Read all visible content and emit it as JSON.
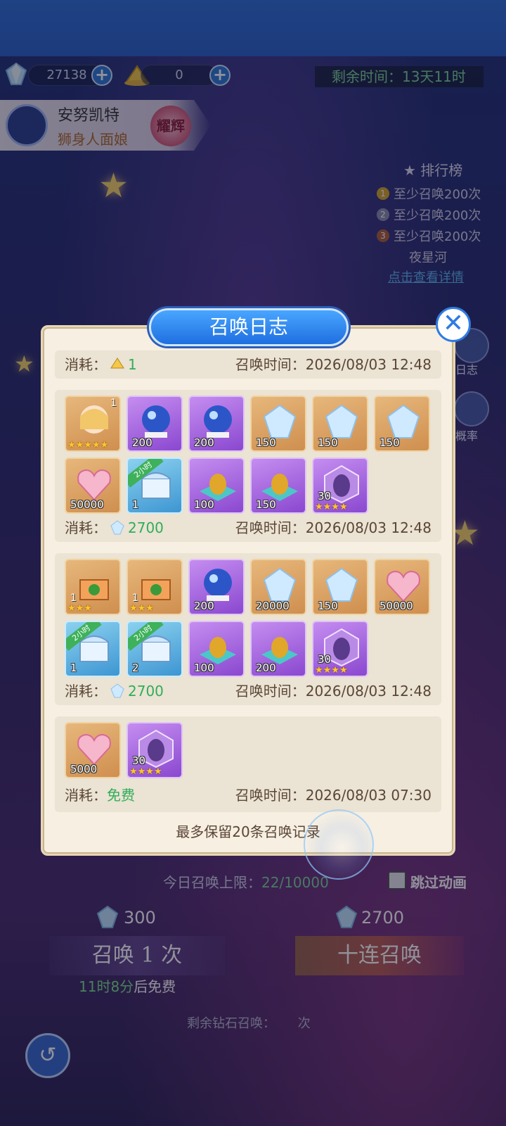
{
  "resources": {
    "gems": "27138",
    "bells": "0"
  },
  "timer": {
    "label": "剩余时间：",
    "value": "13天11时"
  },
  "hero": {
    "name": "安努凯特",
    "subtitle": "狮身人面娘",
    "badge": "耀辉"
  },
  "ranking": {
    "title": "排行榜",
    "lines": [
      "至少召唤200次",
      "至少召唤200次",
      "至少召唤200次"
    ],
    "extra": "夜星河",
    "link": "点击查看详情"
  },
  "side": {
    "log_label": "日志",
    "rate_label": "概率"
  },
  "modal": {
    "title": "召唤日志",
    "footer": "最多保留20条召唤记录",
    "entries": [
      {
        "cost_label": "消耗：",
        "cost_value": "1",
        "time_label": "召唤时间：",
        "time": "2026/08/03 12:48"
      },
      {
        "cost_label": "消耗：",
        "cost_value": "2700",
        "time_label": "召唤时间：",
        "time": "2026/08/03 12:48"
      },
      {
        "cost_label": "消耗：",
        "cost_value": "2700",
        "time_label": "召唤时间：",
        "time": "2026/08/03 12:48"
      },
      {
        "cost_label": "消耗：",
        "cost_value": "免费",
        "time_label": "召唤时间：",
        "time": "2026/08/03 07:30"
      }
    ],
    "items_b1": [
      "1",
      "200",
      "200",
      "150",
      "150",
      "150",
      "50000",
      "1",
      "100",
      "150",
      "30"
    ],
    "items_b2": [
      "1",
      "1",
      "200",
      "20000",
      "150",
      "50000",
      "1",
      "2",
      "100",
      "200",
      "30"
    ],
    "items_b3": [
      "5000",
      "30"
    ],
    "tag_label": "2小时",
    "stars_5": "★★★★★",
    "stars_4": "★★★★",
    "stars_3": "★★★"
  },
  "bottom": {
    "limit_label": "今日召唤上限：",
    "limit_value": "22/10000",
    "skip_label": "跳过动画",
    "single_cost": "300",
    "ten_cost": "2700",
    "single_label": "召唤 1 次",
    "ten_label": "十连召唤",
    "free_time": "11时8分",
    "free_suffix": "后免费",
    "remain_label": "剩余钻石召唤：",
    "remain_suffix": "次"
  },
  "colors": {
    "accent_blue": "#2f7be3",
    "green": "#2fae5a",
    "modal_bg": "#f6efe2"
  }
}
